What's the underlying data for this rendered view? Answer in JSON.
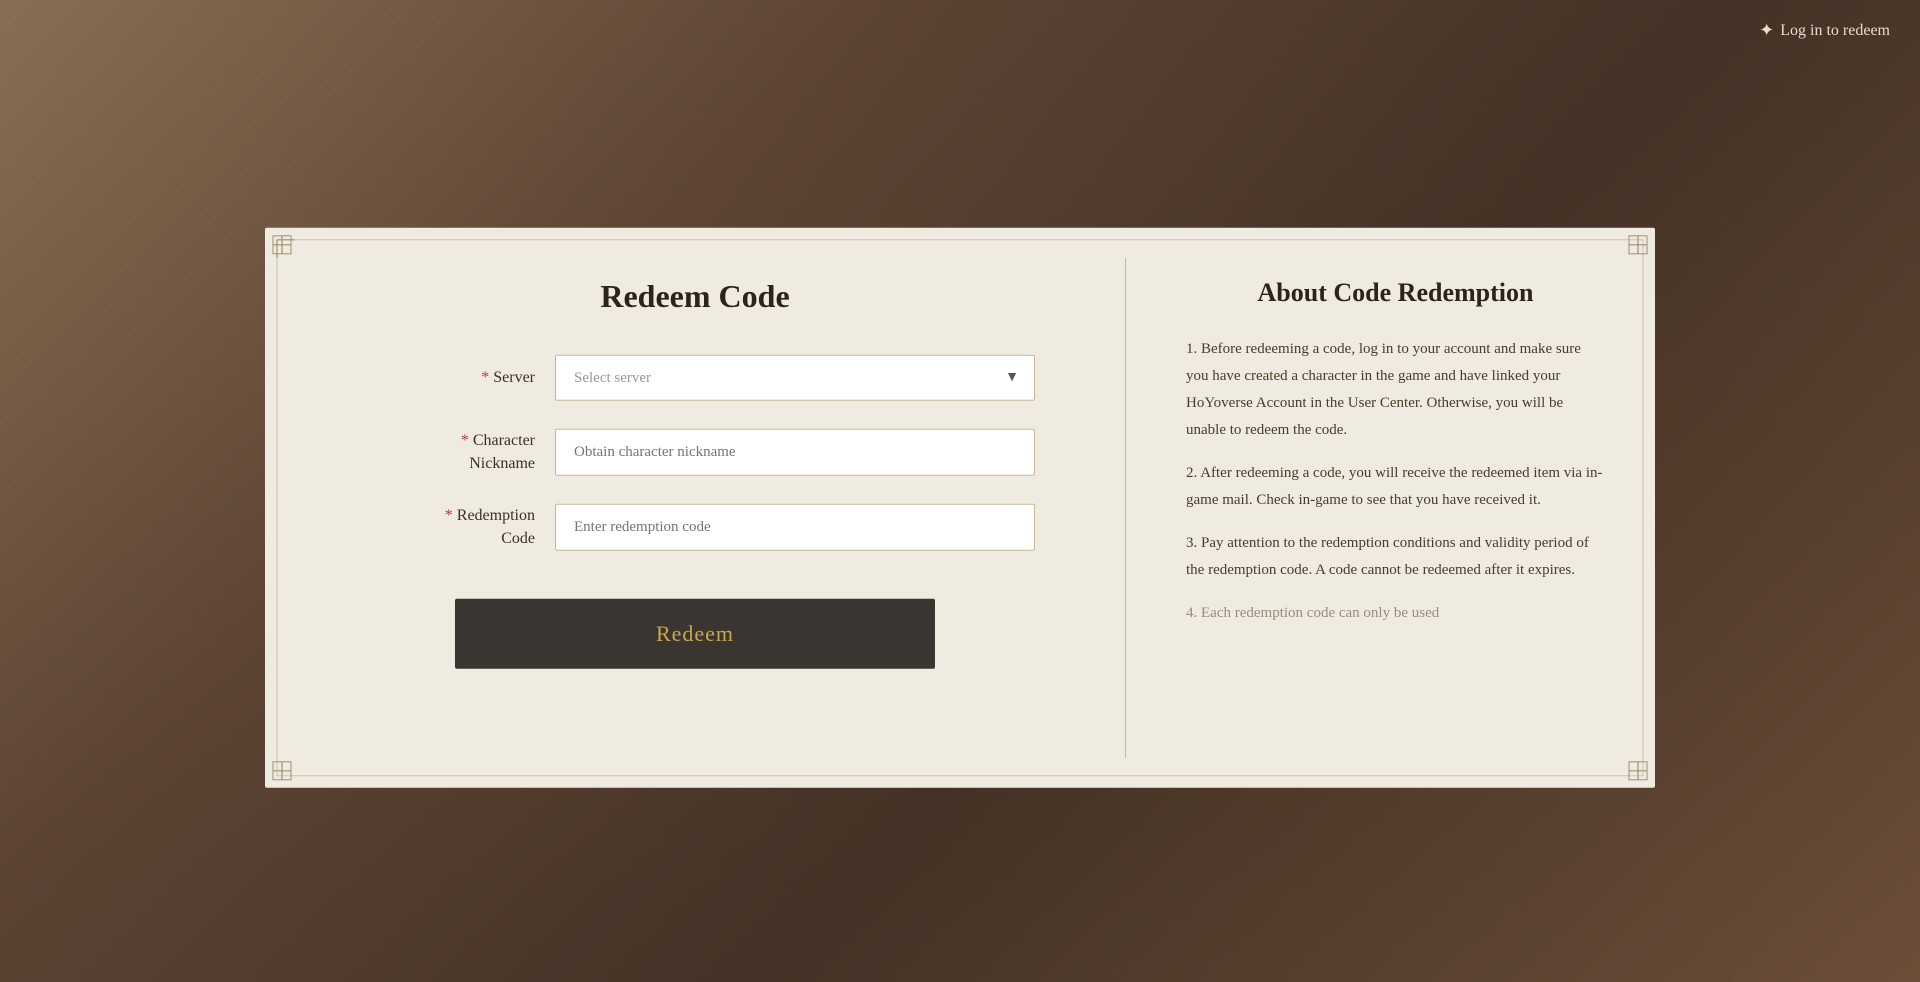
{
  "page": {
    "background_color": "#6b5a4e"
  },
  "header": {
    "login_label": "Log in to redeem",
    "sparkle": "✦"
  },
  "left_panel": {
    "title": "Redeem Code",
    "fields": [
      {
        "id": "server",
        "label": "Server",
        "required": true,
        "type": "select",
        "placeholder": "Select server",
        "value": ""
      },
      {
        "id": "character-nickname",
        "label_line1": "Character",
        "label_line2": "Nickname",
        "required": true,
        "type": "input",
        "placeholder": "Obtain character nickname",
        "value": ""
      },
      {
        "id": "redemption-code",
        "label_line1": "Redemption",
        "label_line2": "Code",
        "required": true,
        "type": "input",
        "placeholder": "Enter redemption code",
        "value": ""
      }
    ],
    "redeem_button": "Redeem"
  },
  "right_panel": {
    "title": "About Code Redemption",
    "items": [
      {
        "number": "1.",
        "text": "Before redeeming a code, log in to your account and make sure you have created a character in the game and have linked your HoYoverse Account in the User Center. Otherwise, you will be unable to redeem the code."
      },
      {
        "number": "2.",
        "text": "After redeeming a code, you will receive the redeemed item via in-game mail. Check in-game to see that you have received it."
      },
      {
        "number": "3.",
        "text": "Pay attention to the redemption conditions and validity period of the redemption code. A code cannot be redeemed after it expires."
      },
      {
        "number": "4.",
        "text": "Each redemption code can only be used",
        "faded": true
      }
    ]
  }
}
